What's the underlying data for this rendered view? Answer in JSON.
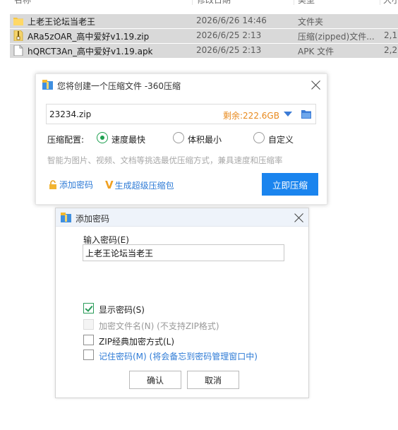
{
  "explorer": {
    "columns": [
      "名称",
      "修改日期",
      "类型",
      "大小"
    ],
    "rows": [
      {
        "name": "上老王论坛当老王",
        "date": "2026/6/26 14:46",
        "type": "文件夹",
        "size": "",
        "icon": "folder-icon"
      },
      {
        "name": "ARa5zOAR_高中爱好v1.19.zip",
        "date": "2026/6/25 2:13",
        "type": "压缩(zipped)文件...",
        "size": "2,1",
        "icon": "zip-file-icon"
      },
      {
        "name": "hQRCT3An_高中爱好v1.19.apk",
        "date": "2026/6/25 2:13",
        "type": "APK 文件",
        "size": "2,2",
        "icon": "document-icon"
      }
    ]
  },
  "compress_dialog": {
    "title": "您将创建一个压缩文件 -360压缩",
    "filename": "23234.zip",
    "remaining": "剩余:222.6GB",
    "config_label": "压缩配置:",
    "options": [
      "速度最快",
      "体积最小",
      "自定义"
    ],
    "selected_option": "速度最快",
    "hint": "智能为图片、视频、文档等挑选最优压缩方式，兼具速度和压缩率",
    "add_password": "添加密码",
    "super_package": "生成超级压缩包",
    "start_button": "立即压缩",
    "accent_color": "#1a84ee",
    "remaining_color": "#e8891c"
  },
  "password_dialog": {
    "title": "添加密码",
    "input_label": "输入密码(E)",
    "password_value": "上老王论坛当老王",
    "checkboxes": [
      {
        "label": "显示密码(S)",
        "checked": true,
        "enabled": true
      },
      {
        "label": "加密文件名(N) (不支持ZIP格式)",
        "checked": false,
        "enabled": false
      },
      {
        "label": "ZIP经典加密方式(L)",
        "checked": false,
        "enabled": true
      },
      {
        "label": "记住密码(M) (将会备忘到密码管理窗口中)",
        "checked": false,
        "enabled": true
      }
    ],
    "ok_button": "确认",
    "cancel_button": "取消"
  }
}
